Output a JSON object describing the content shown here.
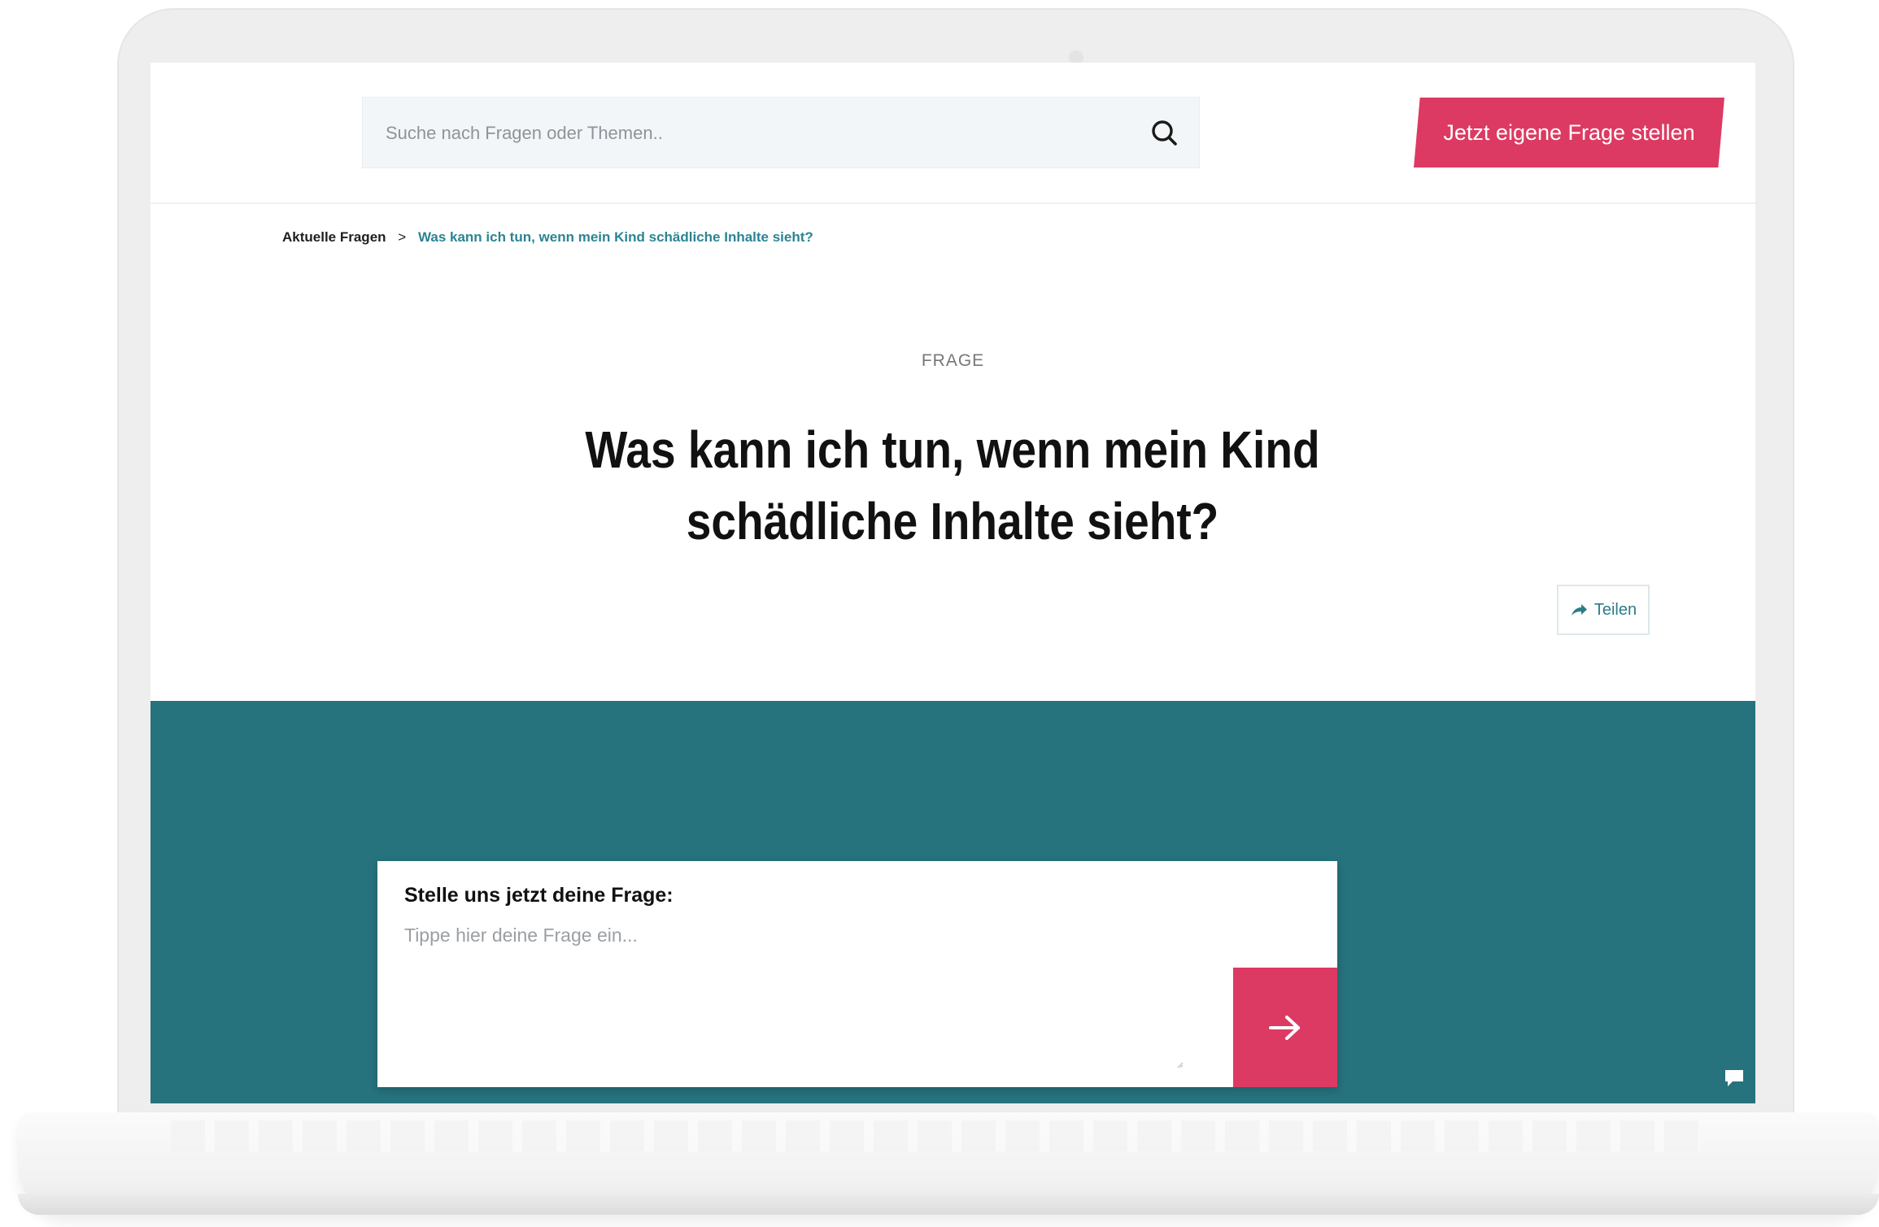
{
  "header": {
    "search_placeholder": "Suche nach Fragen oder Themen..",
    "cta_label": "Jetzt eigene Frage stellen"
  },
  "breadcrumb": {
    "root": "Aktuelle Fragen",
    "separator": ">",
    "current": "Was kann ich tun, wenn mein Kind schädliche Inhalte sieht?"
  },
  "question": {
    "kicker": "FRAGE",
    "title": "Was kann ich tun, wenn mein Kind schädliche Inhalte sieht?"
  },
  "share": {
    "label": "Teilen",
    "icon": "share-arrow-icon"
  },
  "ask_form": {
    "label": "Stelle uns jetzt deine Frage:",
    "placeholder": "Tippe hier deine Frage ein...",
    "submit_icon": "arrow-right-icon"
  },
  "colors": {
    "accent": "#dc3a62",
    "teal": "#26727d",
    "link": "#2b8493"
  }
}
